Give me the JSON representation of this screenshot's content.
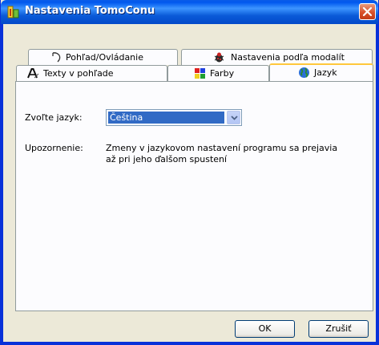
{
  "window": {
    "title": "Nastavenia TomoConu"
  },
  "tabs_back": [
    {
      "label": "Pohľad/Ovládanie",
      "icon": "cursor-icon"
    },
    {
      "label": "Nastavenia podľa modalít",
      "icon": "bug-icon"
    }
  ],
  "tabs_front": [
    {
      "label": "Texty v pohľade",
      "icon": "text-icon"
    },
    {
      "label": "Farby",
      "icon": "palette-icon"
    },
    {
      "label": "Jazyk",
      "icon": "globe-icon",
      "active": true
    }
  ],
  "language": {
    "label": "Zvoľte jazyk:",
    "selected": "Čeština"
  },
  "notice": {
    "label": "Upozornenie:",
    "line1": "Zmeny v jazykovom nastavení programu sa prejavia",
    "line2": "až pri jeho ďalšom spustení"
  },
  "buttons": {
    "ok": "OK",
    "cancel": "Zrušiť"
  },
  "colors": {
    "title_bar": "#0058ee",
    "selection": "#316ac5",
    "active_tab": "#ffc83c"
  }
}
